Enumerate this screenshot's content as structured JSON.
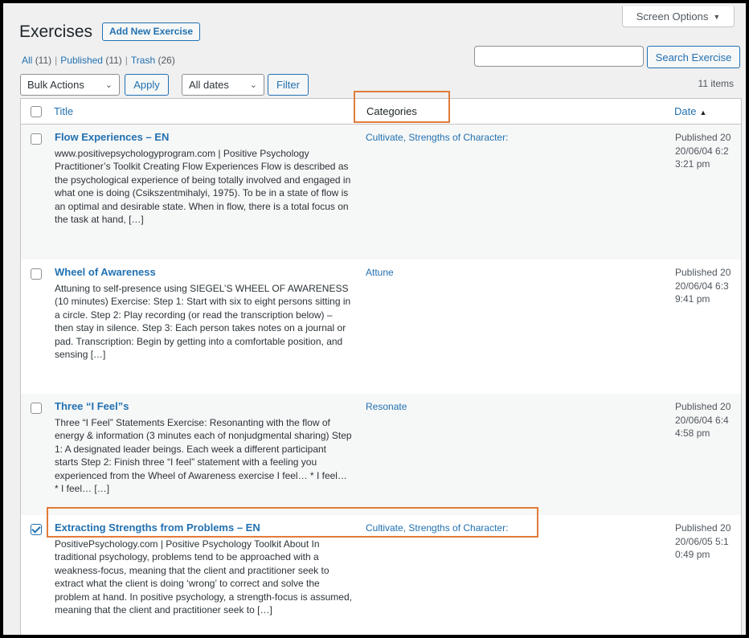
{
  "screen_options": {
    "label": "Screen Options"
  },
  "header": {
    "title": "Exercises",
    "add_new_label": "Add New Exercise"
  },
  "views": {
    "all_label": "All",
    "all_count": "(11)",
    "published_label": "Published",
    "published_count": "(11)",
    "trash_label": "Trash",
    "trash_count": "(26)",
    "separator": "|"
  },
  "search": {
    "placeholder": "",
    "button_label": "Search Exercise"
  },
  "filters": {
    "bulk_actions": "Bulk Actions",
    "apply_label": "Apply",
    "dates": "All dates",
    "filter_label": "Filter",
    "items_count": "11 items"
  },
  "table": {
    "columns": {
      "title": "Title",
      "categories": "Categories",
      "date": "Date"
    },
    "rows": [
      {
        "title": "Flow Experiences – EN",
        "excerpt": "www.positivepsychologyprogram.com |  Positive Psychology Practitioner’s Toolkit Creating Flow Experiences Flow is described as the psychological experience of being totally involved and engaged in what one is doing (Csikszentmihalyi, 1975). To be in a state of flow is an optimal and desirable state. When in flow, there is a total focus on the task at hand, […]",
        "categories": "Cultivate, Strengths of Character:",
        "date": "Published 2020/06/04 6:23:21 pm",
        "checked": false
      },
      {
        "title": "Wheel of Awareness",
        "excerpt": "Attuning to self-presence using SIEGEL’S WHEEL OF AWARENESS (10 minutes) Exercise:  Step 1: Start with six to eight persons sitting in a circle.  Step 2: Play recording (or read the transcription below) – then stay in silence. Step 3: Each person takes notes on a journal or pad. Transcription: Begin by getting into a comfortable position, and sensing […]",
        "categories": "Attune",
        "date": "Published 2020/06/04 6:39:41 pm",
        "checked": false
      },
      {
        "title": "Three “I Feel”s",
        "excerpt": "Three “I Feel” Statements Exercise: Resonanting with the flow of energy & information (3 minutes each of nonjudgmental sharing) Step 1: A designated leader beings. Each week a different participant starts Step 2: Finish three “I feel” statement with a feeling you experienced from the Wheel of Awareness exercise I feel… * I feel… * I feel… […]",
        "categories": "Resonate",
        "date": "Published 2020/06/04 6:44:58 pm",
        "checked": false
      },
      {
        "title": "Extracting Strengths from Problems – EN",
        "excerpt": "PositivePsychology.com | Positive Psychology Toolkit About In traditional psychology, problems tend to be approached with a weakness-focus, meaning that the client and practitioner seek to extract what the client is doing ‘wrong’ to correct and solve the problem at hand. In positive psychology, a strength-focus is assumed, meaning that the client and practitioner seek to […]",
        "categories": "Cultivate, Strengths of Character:",
        "date": "Published 2020/06/05 5:10:49 pm",
        "checked": true
      }
    ]
  },
  "colors": {
    "link": "#2271b1",
    "highlight": "#e07b39",
    "alt_row": "#f6f7f7"
  }
}
